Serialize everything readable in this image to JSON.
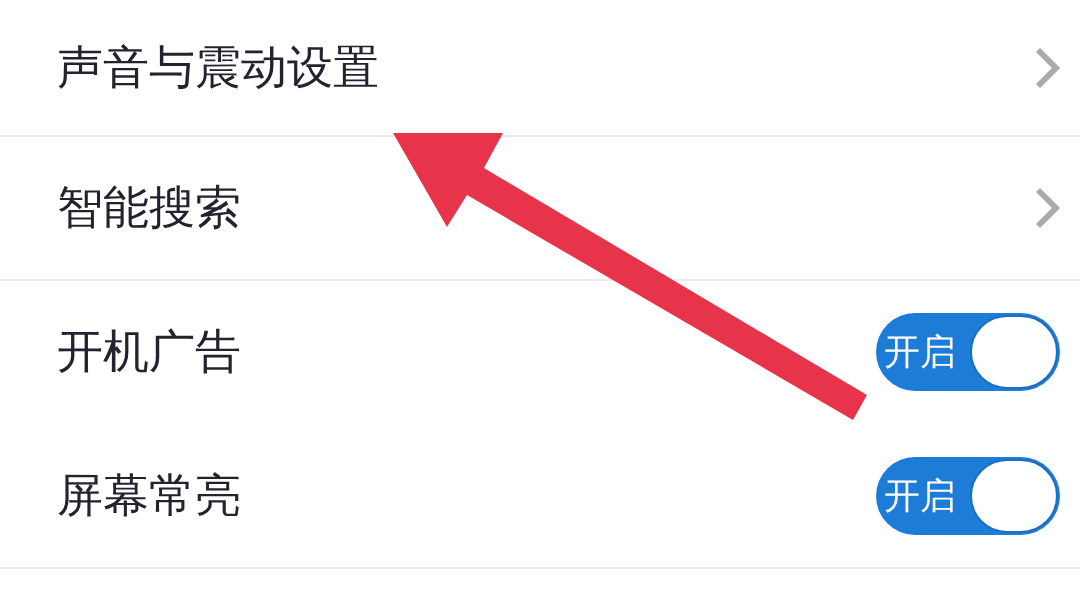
{
  "rows": [
    {
      "kind": "link",
      "label": "声音与震动设置",
      "divider_below": true
    },
    {
      "kind": "link",
      "label": "智能搜索",
      "divider_below": true
    },
    {
      "kind": "toggle",
      "label": "开机广告",
      "on": true,
      "state_label": "开启",
      "divider_below": false
    },
    {
      "kind": "toggle",
      "label": "屏幕常亮",
      "on": true,
      "state_label": "开启",
      "divider_below": true
    }
  ],
  "annotations": [
    {
      "kind": "arrow"
    }
  ]
}
